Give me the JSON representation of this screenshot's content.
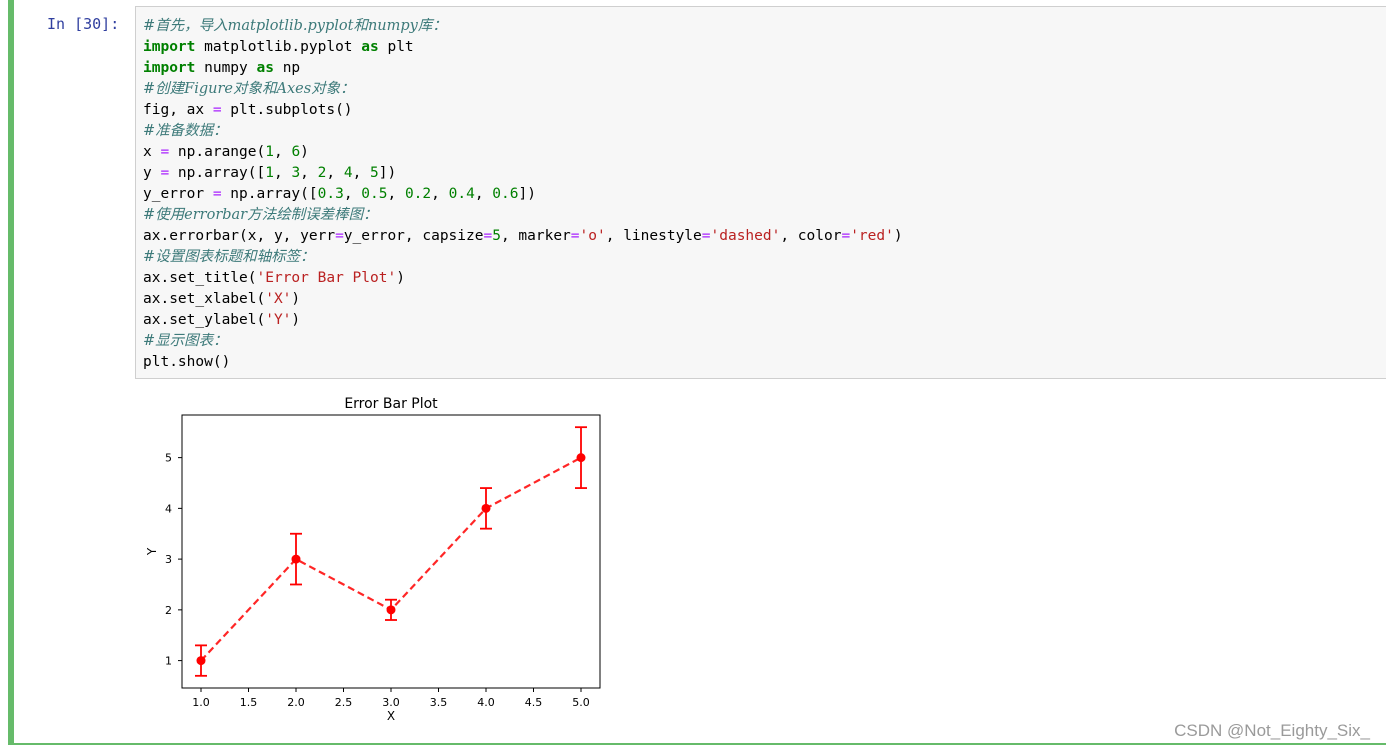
{
  "cell": {
    "prompt": "In  [30]:",
    "code_lines": [
      [
        {
          "t": "cm",
          "v": "#首先，导入matplotlib.pyplot和numpy库："
        }
      ],
      [
        {
          "t": "kw",
          "v": "import"
        },
        {
          "t": "n",
          "v": " matplotlib.pyplot "
        },
        {
          "t": "kw",
          "v": "as"
        },
        {
          "t": "n",
          "v": " plt"
        }
      ],
      [
        {
          "t": "kw",
          "v": "import"
        },
        {
          "t": "n",
          "v": " numpy "
        },
        {
          "t": "kw",
          "v": "as"
        },
        {
          "t": "n",
          "v": " np"
        }
      ],
      [
        {
          "t": "cm",
          "v": "#创建Figure对象和Axes对象："
        }
      ],
      [
        {
          "t": "n",
          "v": "fig, ax "
        },
        {
          "t": "op",
          "v": "="
        },
        {
          "t": "n",
          "v": " plt.subplots()"
        }
      ],
      [
        {
          "t": "cm",
          "v": "#准备数据："
        }
      ],
      [
        {
          "t": "n",
          "v": "x "
        },
        {
          "t": "op",
          "v": "="
        },
        {
          "t": "n",
          "v": " np.arange("
        },
        {
          "t": "num",
          "v": "1"
        },
        {
          "t": "n",
          "v": ", "
        },
        {
          "t": "num",
          "v": "6"
        },
        {
          "t": "n",
          "v": ")"
        }
      ],
      [
        {
          "t": "n",
          "v": "y "
        },
        {
          "t": "op",
          "v": "="
        },
        {
          "t": "n",
          "v": " np.array(["
        },
        {
          "t": "num",
          "v": "1"
        },
        {
          "t": "n",
          "v": ", "
        },
        {
          "t": "num",
          "v": "3"
        },
        {
          "t": "n",
          "v": ", "
        },
        {
          "t": "num",
          "v": "2"
        },
        {
          "t": "n",
          "v": ", "
        },
        {
          "t": "num",
          "v": "4"
        },
        {
          "t": "n",
          "v": ", "
        },
        {
          "t": "num",
          "v": "5"
        },
        {
          "t": "n",
          "v": "])"
        }
      ],
      [
        {
          "t": "n",
          "v": "y_error "
        },
        {
          "t": "op",
          "v": "="
        },
        {
          "t": "n",
          "v": " np.array(["
        },
        {
          "t": "num",
          "v": "0.3"
        },
        {
          "t": "n",
          "v": ", "
        },
        {
          "t": "num",
          "v": "0.5"
        },
        {
          "t": "n",
          "v": ", "
        },
        {
          "t": "num",
          "v": "0.2"
        },
        {
          "t": "n",
          "v": ", "
        },
        {
          "t": "num",
          "v": "0.4"
        },
        {
          "t": "n",
          "v": ", "
        },
        {
          "t": "num",
          "v": "0.6"
        },
        {
          "t": "n",
          "v": "])"
        }
      ],
      [
        {
          "t": "cm",
          "v": "#使用errorbar方法绘制误差棒图："
        }
      ],
      [
        {
          "t": "n",
          "v": "ax.errorbar(x, y, yerr"
        },
        {
          "t": "op",
          "v": "="
        },
        {
          "t": "n",
          "v": "y_error, capsize"
        },
        {
          "t": "op",
          "v": "="
        },
        {
          "t": "num",
          "v": "5"
        },
        {
          "t": "n",
          "v": ", marker"
        },
        {
          "t": "op",
          "v": "="
        },
        {
          "t": "str",
          "v": "'o'"
        },
        {
          "t": "n",
          "v": ", linestyle"
        },
        {
          "t": "op",
          "v": "="
        },
        {
          "t": "str",
          "v": "'dashed'"
        },
        {
          "t": "n",
          "v": ", color"
        },
        {
          "t": "op",
          "v": "="
        },
        {
          "t": "str",
          "v": "'red'"
        },
        {
          "t": "n",
          "v": ")"
        }
      ],
      [
        {
          "t": "cm",
          "v": "#设置图表标题和轴标签："
        }
      ],
      [
        {
          "t": "n",
          "v": "ax.set_title("
        },
        {
          "t": "str",
          "v": "'Error Bar Plot'"
        },
        {
          "t": "n",
          "v": ")"
        }
      ],
      [
        {
          "t": "n",
          "v": "ax.set_xlabel("
        },
        {
          "t": "str",
          "v": "'X'"
        },
        {
          "t": "n",
          "v": ")"
        }
      ],
      [
        {
          "t": "n",
          "v": "ax.set_ylabel("
        },
        {
          "t": "str",
          "v": "'Y'"
        },
        {
          "t": "n",
          "v": ")"
        }
      ],
      [
        {
          "t": "cm",
          "v": "#显示图表："
        }
      ],
      [
        {
          "t": "n",
          "v": "plt.show()"
        }
      ]
    ]
  },
  "chart_data": {
    "type": "line",
    "title": "Error Bar Plot",
    "xlabel": "X",
    "ylabel": "Y",
    "x": [
      1,
      2,
      3,
      4,
      5
    ],
    "y": [
      1,
      3,
      2,
      4,
      5
    ],
    "y_error": [
      0.3,
      0.5,
      0.2,
      0.4,
      0.6
    ],
    "xlim": [
      0.8,
      5.2
    ],
    "ylim": [
      0.46,
      5.84
    ],
    "xticks": [
      "1.0",
      "1.5",
      "2.0",
      "2.5",
      "3.0",
      "3.5",
      "4.0",
      "4.5",
      "5.0"
    ],
    "yticks": [
      "1",
      "2",
      "3",
      "4",
      "5"
    ],
    "color": "#ff0000",
    "linestyle": "dashed",
    "marker": "o",
    "grid": false
  },
  "watermark": "CSDN @Not_Eighty_Six_"
}
